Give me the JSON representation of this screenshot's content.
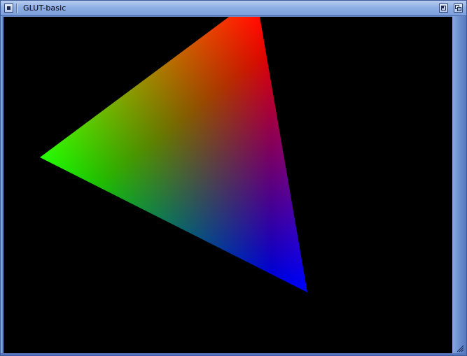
{
  "window": {
    "title": "GLUT-basic",
    "frame_color": "#6a8fd0",
    "canvas_background": "#000000"
  },
  "titlebar": {
    "close_icon": "close-gadget-icon",
    "zoom_icon": "zoom-gadget-icon",
    "depth_icon": "depth-gadget-icon"
  },
  "scene": {
    "shape": "triangle",
    "vertex_colors": [
      "#ff0000",
      "#00ff00",
      "#0000ff"
    ]
  },
  "resize": {
    "icon": "resize-grip-icon"
  }
}
